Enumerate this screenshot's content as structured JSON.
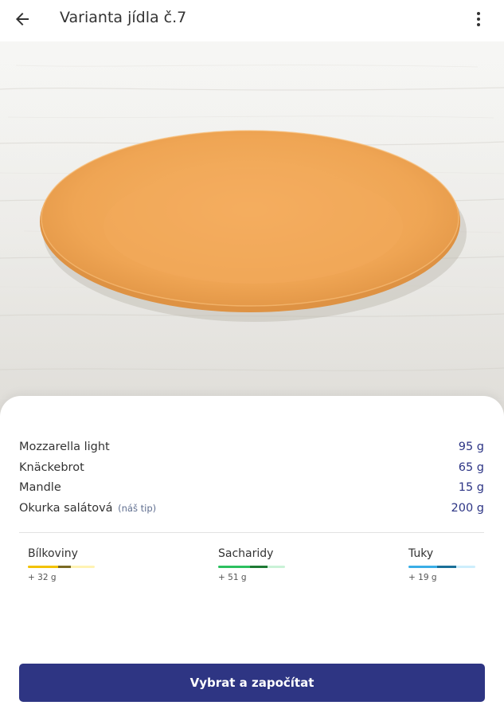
{
  "header": {
    "title": "Varianta jídla č.7",
    "back_icon": "arrow-left-icon",
    "menu_icon": "more-vert-icon"
  },
  "hero_image": {
    "description_icon": "plate-image",
    "plate_color": "#f0a85a"
  },
  "foods": [
    {
      "name": "Mozzarella light",
      "note": "",
      "amount": "95 g"
    },
    {
      "name": "Knäckebrot",
      "note": "",
      "amount": "65 g"
    },
    {
      "name": "Mandle",
      "note": "",
      "amount": "15 g"
    },
    {
      "name": "Okurka salátová",
      "note": "(náš tip)",
      "amount": "200 g"
    }
  ],
  "macros": [
    {
      "label": "Bílkoviny",
      "value": "+ 32 g",
      "color_light": "#fff3b3",
      "color_main": "#f2c200",
      "color_dark": "#7a6a23"
    },
    {
      "label": "Sacharidy",
      "value": "+ 51 g",
      "color_light": "#c9f2d6",
      "color_main": "#2cc05f",
      "color_dark": "#1d7a34"
    },
    {
      "label": "Tuky",
      "value": "+ 19 g",
      "color_light": "#cdeefc",
      "color_main": "#3aaee6",
      "color_dark": "#1a6f98"
    }
  ],
  "actions": {
    "primary_label": "Vybrat a započítat",
    "primary_color": "#2e3583"
  }
}
